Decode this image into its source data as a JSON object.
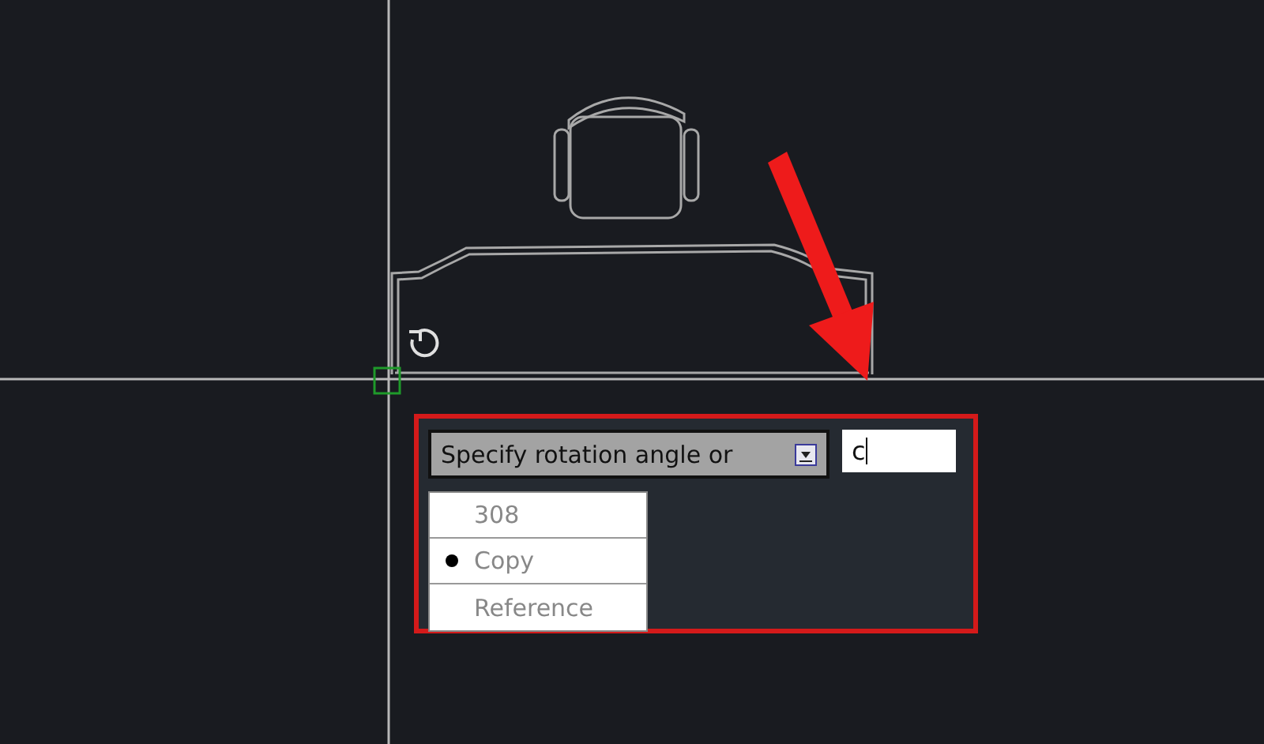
{
  "prompt": {
    "text": "Specify rotation angle or"
  },
  "input": {
    "value": "c"
  },
  "options": [
    {
      "label": "308",
      "selected": false
    },
    {
      "label": "Copy",
      "selected": true
    },
    {
      "label": "Reference",
      "selected": false
    }
  ]
}
